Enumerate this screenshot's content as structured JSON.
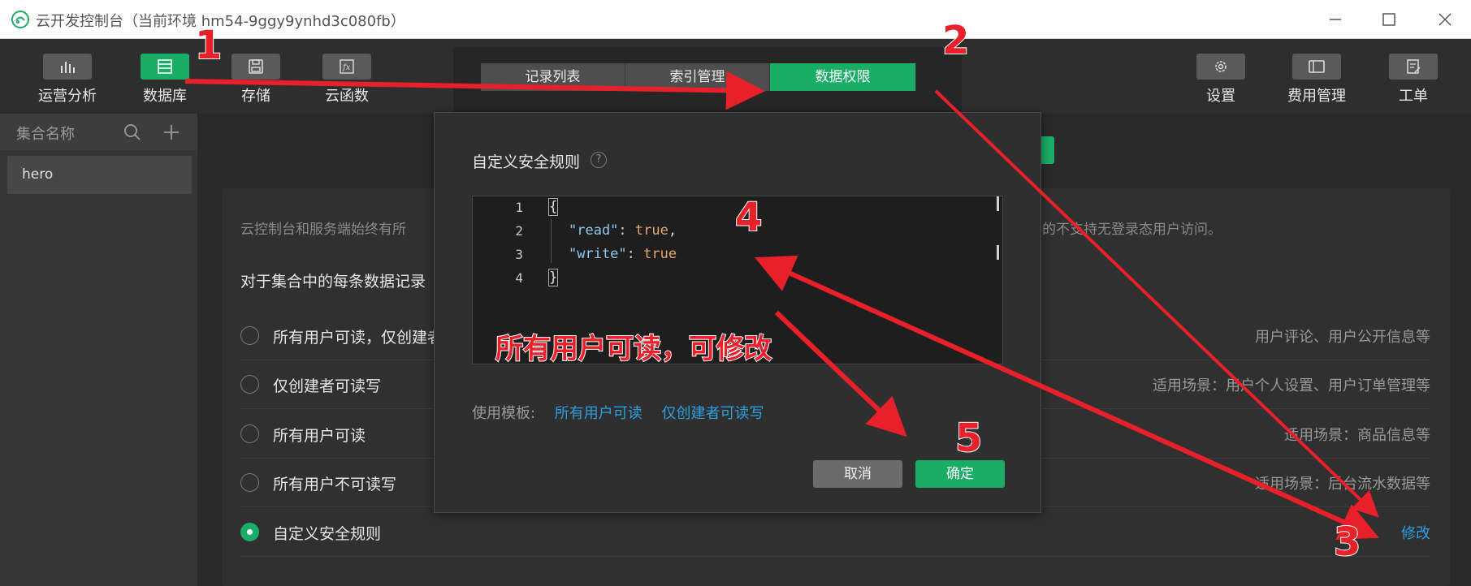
{
  "window": {
    "title": "云开发控制台（当前环境 hm54-9ggy9ynhd3c080fb）"
  },
  "toolbar": {
    "left": [
      {
        "label": "运营分析",
        "icon": "bar-chart-icon"
      },
      {
        "label": "数据库",
        "icon": "database-icon"
      },
      {
        "label": "存储",
        "icon": "storage-icon"
      },
      {
        "label": "云函数",
        "icon": "function-icon"
      }
    ],
    "right": [
      {
        "label": "设置",
        "icon": "gear-icon"
      },
      {
        "label": "费用管理",
        "icon": "wallet-icon"
      },
      {
        "label": "工单",
        "icon": "ticket-icon"
      }
    ]
  },
  "sidebar": {
    "header": "集合名称",
    "items": [
      "hero"
    ]
  },
  "tabs": [
    {
      "label": "记录列表",
      "active": false
    },
    {
      "label": "索引管理",
      "active": false
    },
    {
      "label": "数据权限",
      "active": true
    }
  ],
  "panel": {
    "desc_left": "云控制台和服务端始终有所",
    "desc_right": "的不支持无登录态用户访问。",
    "section": "对于集合中的每条数据记录",
    "options": [
      {
        "label": "所有用户可读，仅创建者",
        "hint": "用户评论、用户公开信息等",
        "checked": false
      },
      {
        "label": "仅创建者可读写",
        "hint": "适用场景：用户个人设置、用户订单管理等",
        "checked": false
      },
      {
        "label": "所有用户可读",
        "hint": "适用场景：商品信息等",
        "checked": false
      },
      {
        "label": "所有用户不可读写",
        "hint": "适用场景：后台流水数据等",
        "checked": false
      },
      {
        "label": "自定义安全规则",
        "hint": "修改",
        "checked": true
      }
    ]
  },
  "dialog": {
    "title": "自定义安全规则",
    "help": "?",
    "code": {
      "line_numbers": [
        "1",
        "2",
        "3",
        "4"
      ],
      "lines": [
        {
          "open": "{"
        },
        {
          "key": "\"read\"",
          "sep": ": ",
          "value": "true",
          "tail": ","
        },
        {
          "key": "\"write\"",
          "sep": ": ",
          "value": "true",
          "tail": ""
        },
        {
          "close": "}"
        }
      ]
    },
    "template_label": "使用模板:",
    "template_links": [
      "所有用户可读",
      "仅创建者可读写"
    ],
    "cancel": "取消",
    "confirm": "确定"
  },
  "annotations": {
    "steps": [
      "1",
      "2",
      "3",
      "4",
      "5"
    ],
    "note": "所有用户可读，可修改",
    "color": "#e8202a"
  },
  "colors": {
    "accent": "#1aad66",
    "link": "#2d9ee0",
    "annotation": "#e8202a"
  }
}
